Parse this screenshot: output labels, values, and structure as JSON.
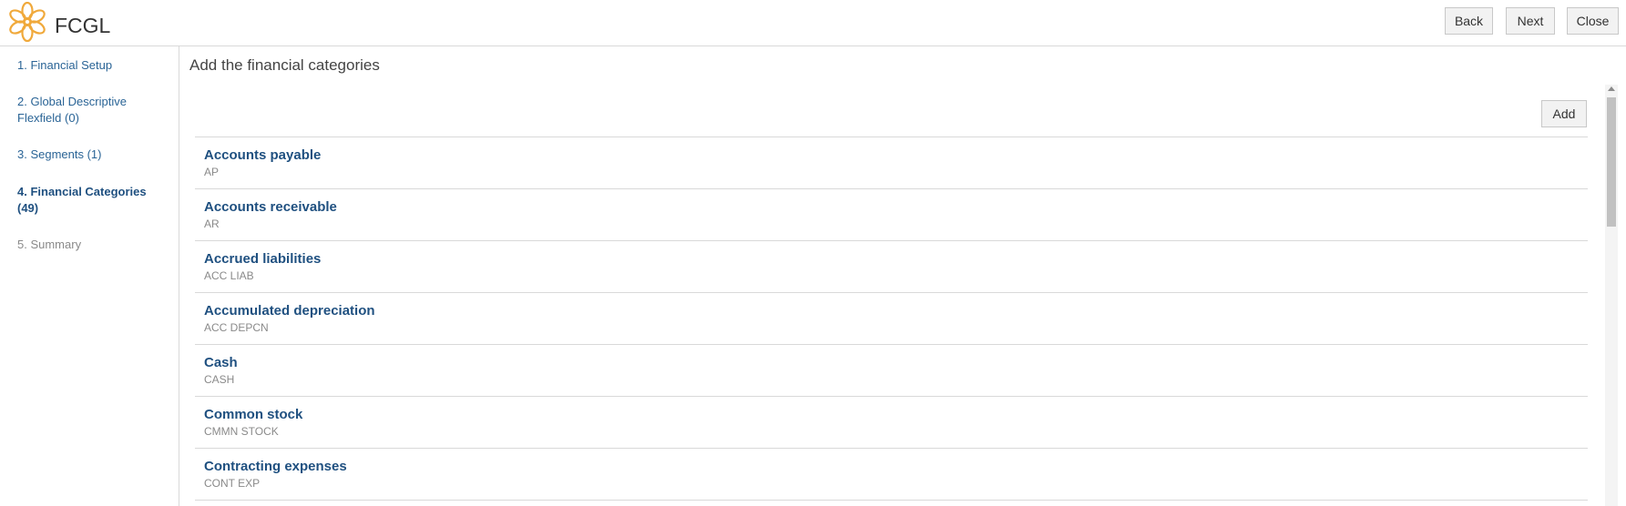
{
  "app": {
    "title": "FCGL",
    "logo_icon": "flower-logo-icon",
    "logo_color": "#f0a93b"
  },
  "header": {
    "back_label": "Back",
    "next_label": "Next",
    "close_label": "Close"
  },
  "sidebar": {
    "steps": [
      {
        "label": "1. Financial Setup",
        "state": "link"
      },
      {
        "label": "2. Global Descriptive Flexfield (0)",
        "state": "link"
      },
      {
        "label": "3. Segments (1)",
        "state": "link"
      },
      {
        "label": "4. Financial Categories (49)",
        "state": "active"
      },
      {
        "label": "5. Summary",
        "state": "disabled"
      }
    ]
  },
  "main": {
    "title": "Add the financial categories",
    "add_label": "Add",
    "categories": [
      {
        "name": "Accounts payable",
        "code": "AP"
      },
      {
        "name": "Accounts receivable",
        "code": "AR"
      },
      {
        "name": "Accrued liabilities",
        "code": "ACC LIAB"
      },
      {
        "name": "Accumulated depreciation",
        "code": "ACC DEPCN"
      },
      {
        "name": "Cash",
        "code": "CASH"
      },
      {
        "name": "Common stock",
        "code": "CMMN STOCK"
      },
      {
        "name": "Contracting expenses",
        "code": "CONT EXP"
      }
    ]
  },
  "colors": {
    "link": "#2a6496",
    "heading_link": "#1f5080",
    "muted": "#8a8a8a",
    "border": "#d9d9d9"
  }
}
